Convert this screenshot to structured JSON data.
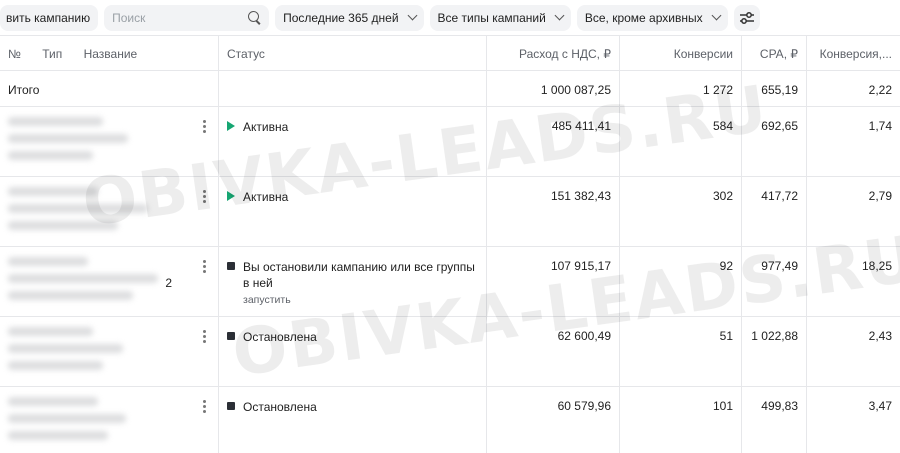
{
  "toolbar": {
    "add_label": "вить кампанию",
    "search_placeholder": "Поиск",
    "filter_period": "Последние 365 дней",
    "filter_types": "Все типы кампаний",
    "filter_archive": "Все, кроме архивных"
  },
  "columns": {
    "num": "№",
    "type": "Тип",
    "name": "Название",
    "status": "Статус",
    "cost": "Расход с НДС, ₽",
    "conversions": "Конверсии",
    "cpa": "CPA, ₽",
    "conv_rate": "Конверсия,..."
  },
  "total": {
    "label": "Итого",
    "cost": "1 000 087,25",
    "conversions": "1 272",
    "cpa": "655,19",
    "conv_rate": "2,22"
  },
  "rows": [
    {
      "status": "Активна",
      "status_kind": "active",
      "cost": "485 411,41",
      "conversions": "584",
      "cpa": "692,65",
      "conv_rate": "1,74"
    },
    {
      "status": "Активна",
      "status_kind": "active",
      "cost": "151 382,43",
      "conversions": "302",
      "cpa": "417,72",
      "conv_rate": "2,79"
    },
    {
      "status": "Вы остановили кампанию или все группы в ней",
      "status_kind": "stopped",
      "action": "запустить",
      "name_suffix": "2",
      "cost": "107 915,17",
      "conversions": "92",
      "cpa": "977,49",
      "conv_rate": "18,25"
    },
    {
      "status": "Остановлена",
      "status_kind": "stopped",
      "cost": "62 600,49",
      "conversions": "51",
      "cpa": "1 022,88",
      "conv_rate": "2,43"
    },
    {
      "status": "Остановлена",
      "status_kind": "stopped",
      "cost": "60 579,96",
      "conversions": "101",
      "cpa": "499,83",
      "conv_rate": "3,47"
    }
  ],
  "watermark": "OBIVKA-LEADS.RU",
  "colors": {
    "active": "#16a672",
    "stopped": "#2b2f36",
    "chip_bg": "#f2f3f5"
  }
}
